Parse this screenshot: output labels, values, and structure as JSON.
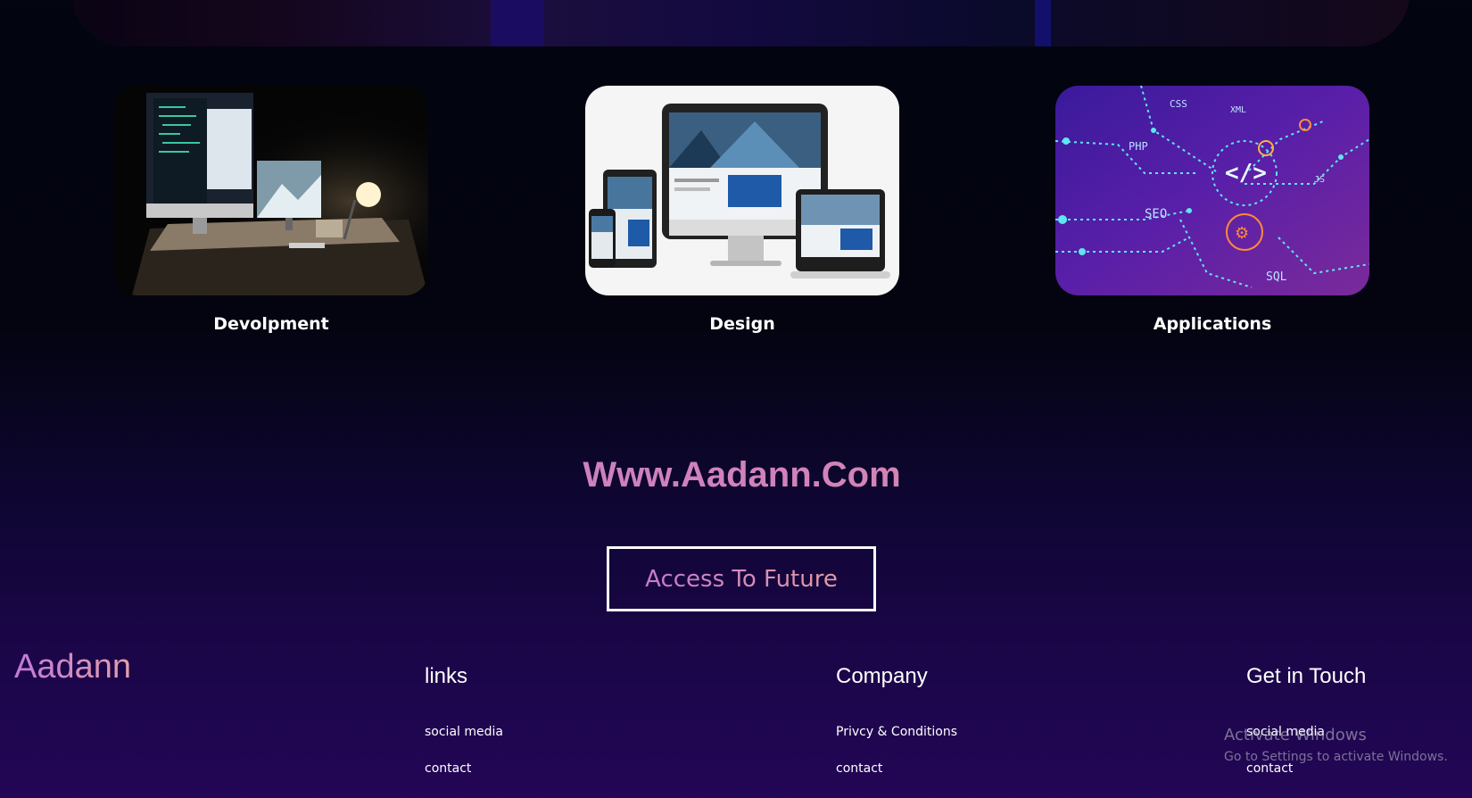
{
  "services": [
    {
      "label": "Devolpment",
      "image": "developer-desk-monitors"
    },
    {
      "label": "Design",
      "image": "responsive-devices-mockup"
    },
    {
      "label": "Applications",
      "image": "web-technologies-circuit"
    }
  ],
  "site_name": "Www.Aadann.Com",
  "cta": {
    "label": "Access To Future"
  },
  "footer": {
    "brand": "Aadann",
    "columns": [
      {
        "title": "links",
        "items": [
          "social media",
          "contact"
        ]
      },
      {
        "title": "Company",
        "items": [
          "Privcy & Conditions",
          "contact"
        ]
      },
      {
        "title": "Get in Touch",
        "items": [
          "social media",
          "contact"
        ]
      }
    ]
  },
  "watermark": {
    "line1": "Activate Windows",
    "line2": "Go to Settings to activate Windows."
  },
  "circuit_tags": [
    "CSS",
    "PHP",
    "SEO",
    "SQL",
    "XML",
    "JS"
  ],
  "colors": {
    "accent_pink": "#cf7dbd",
    "accent_purple": "#c47ad0",
    "bg_top": "#02040f",
    "bg_bottom": "#230656"
  }
}
